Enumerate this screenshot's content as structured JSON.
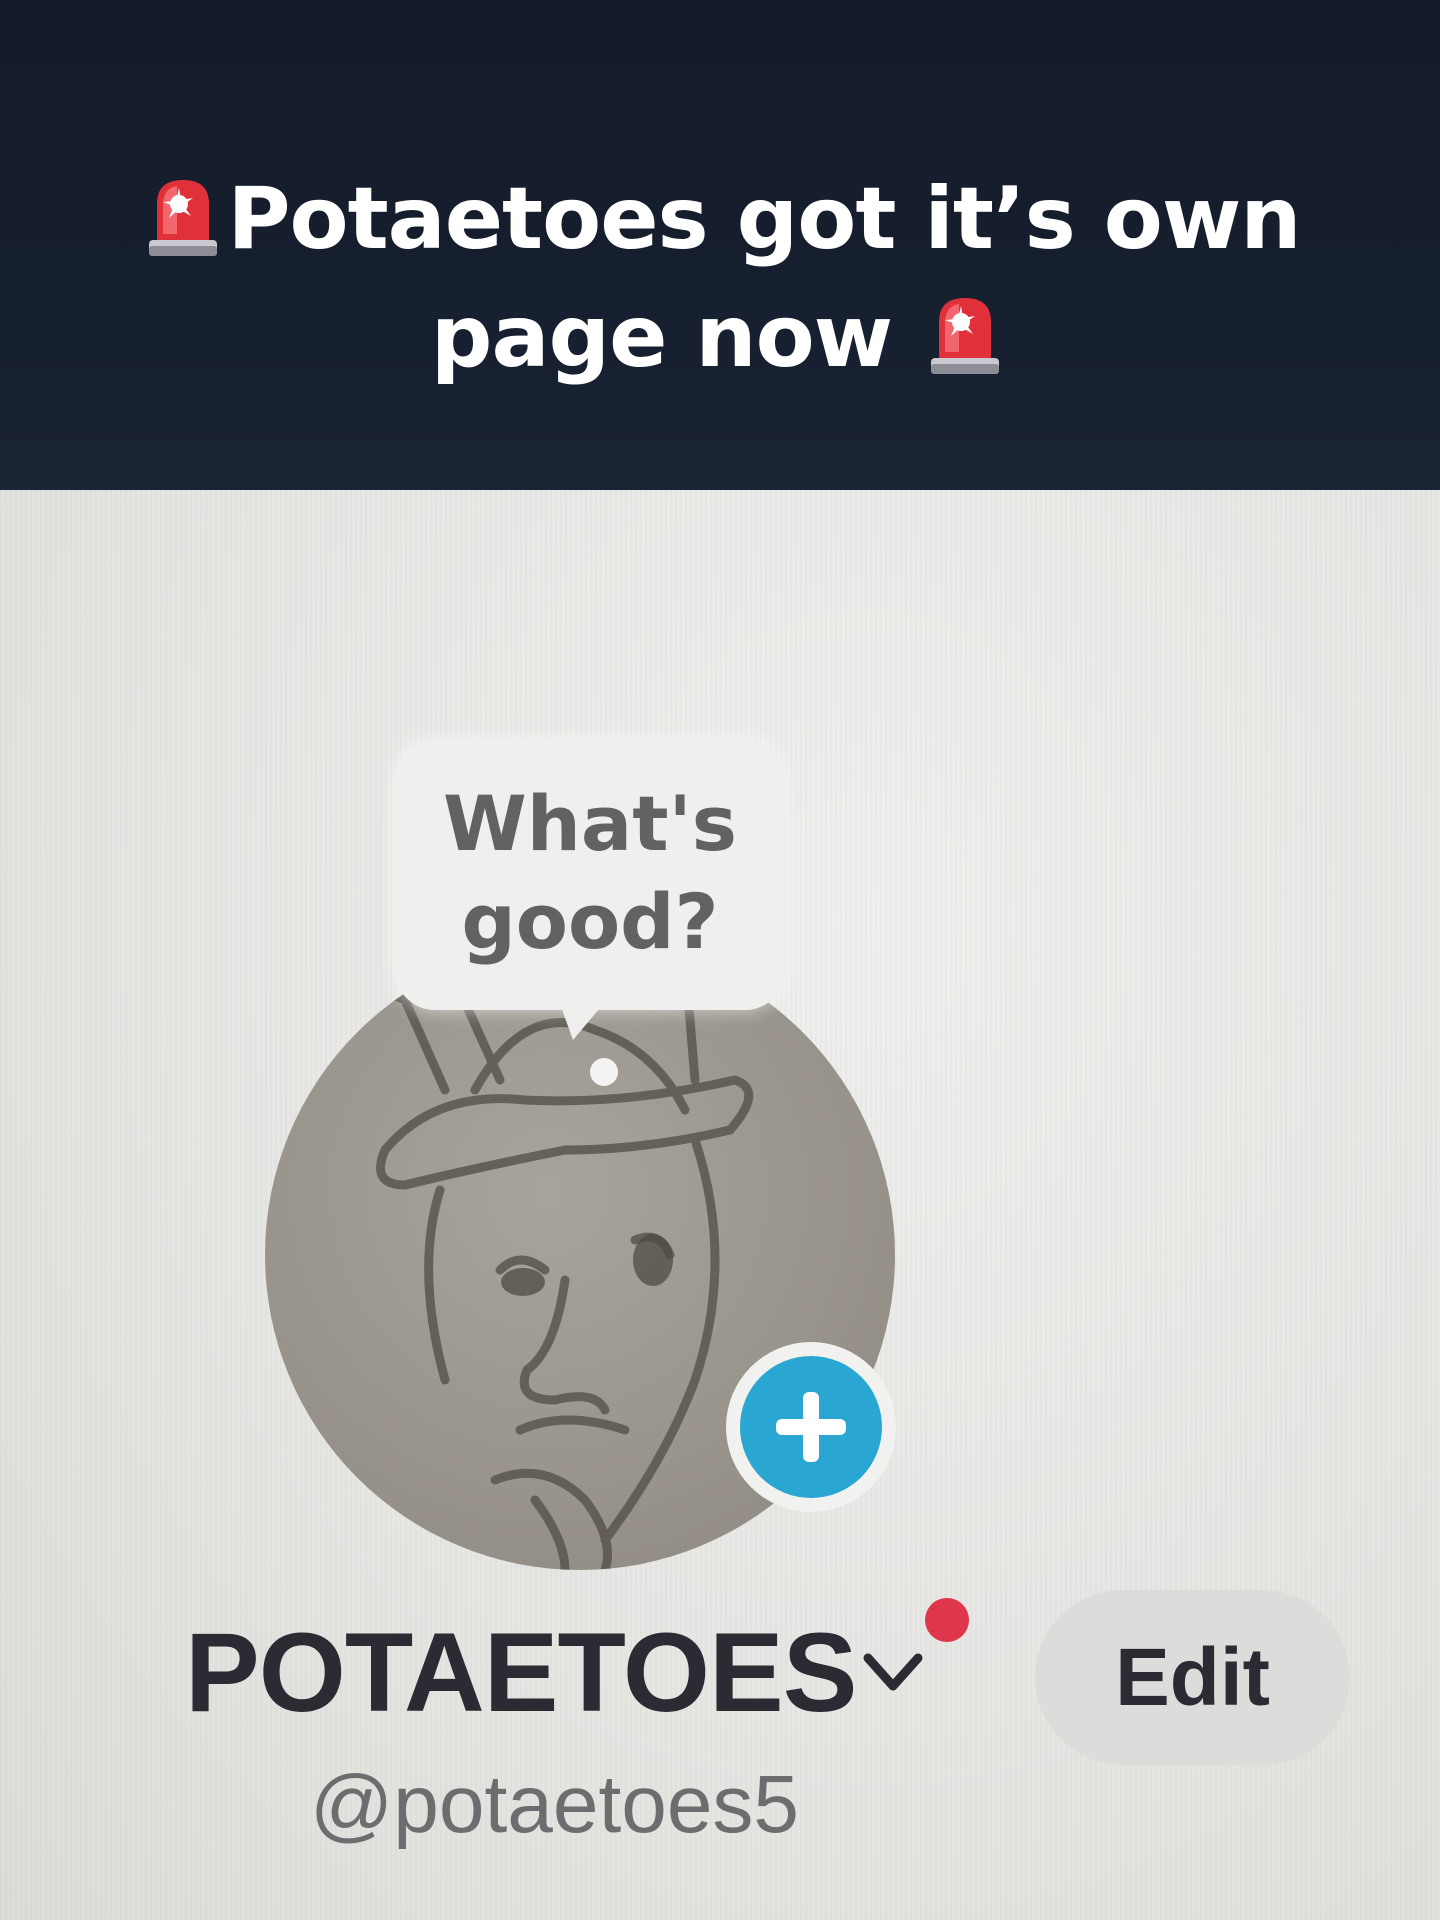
{
  "caption": {
    "line1": "Potaetoes got it’s own",
    "line2": "page now",
    "emoji_icon": "police-light-siren-icon"
  },
  "profile": {
    "bubble_line1": "What's",
    "bubble_line2": "good?",
    "display_name": "POTAETOES",
    "username": "@potaetoes5",
    "edit_label": "Edit",
    "add_icon": "plus-icon",
    "verified_icon": "chevron-down-icon"
  },
  "colors": {
    "caption_band": "#141b2a",
    "add_button": "#29a6d2",
    "notification_dot": "#e0364c",
    "screen_background": "#e7e7e5"
  }
}
